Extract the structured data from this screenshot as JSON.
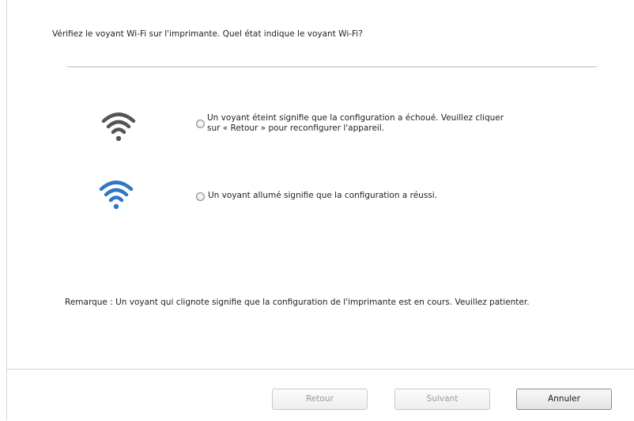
{
  "dialog": {
    "question": "Vérifiez le voyant Wi-Fi sur l'imprimante. Quel état indique le voyant Wi-Fi?",
    "options": [
      {
        "icon": "wifi-off-icon",
        "color": "#555555",
        "line1": "Un voyant éteint signifie que la configuration a échoué. Veuillez cliquer",
        "line2": "sur « Retour » pour reconfigurer l'appareil."
      },
      {
        "icon": "wifi-on-icon",
        "color": "#2f77c6",
        "line1": "Un voyant allumé signifie que la configuration a réussi."
      }
    ],
    "remark": "Remarque : Un voyant qui clignote signifie que la configuration de l'imprimante est en cours. Veuillez patienter."
  },
  "footer": {
    "back_label": "Retour",
    "next_label": "Suivant",
    "cancel_label": "Annuler"
  }
}
